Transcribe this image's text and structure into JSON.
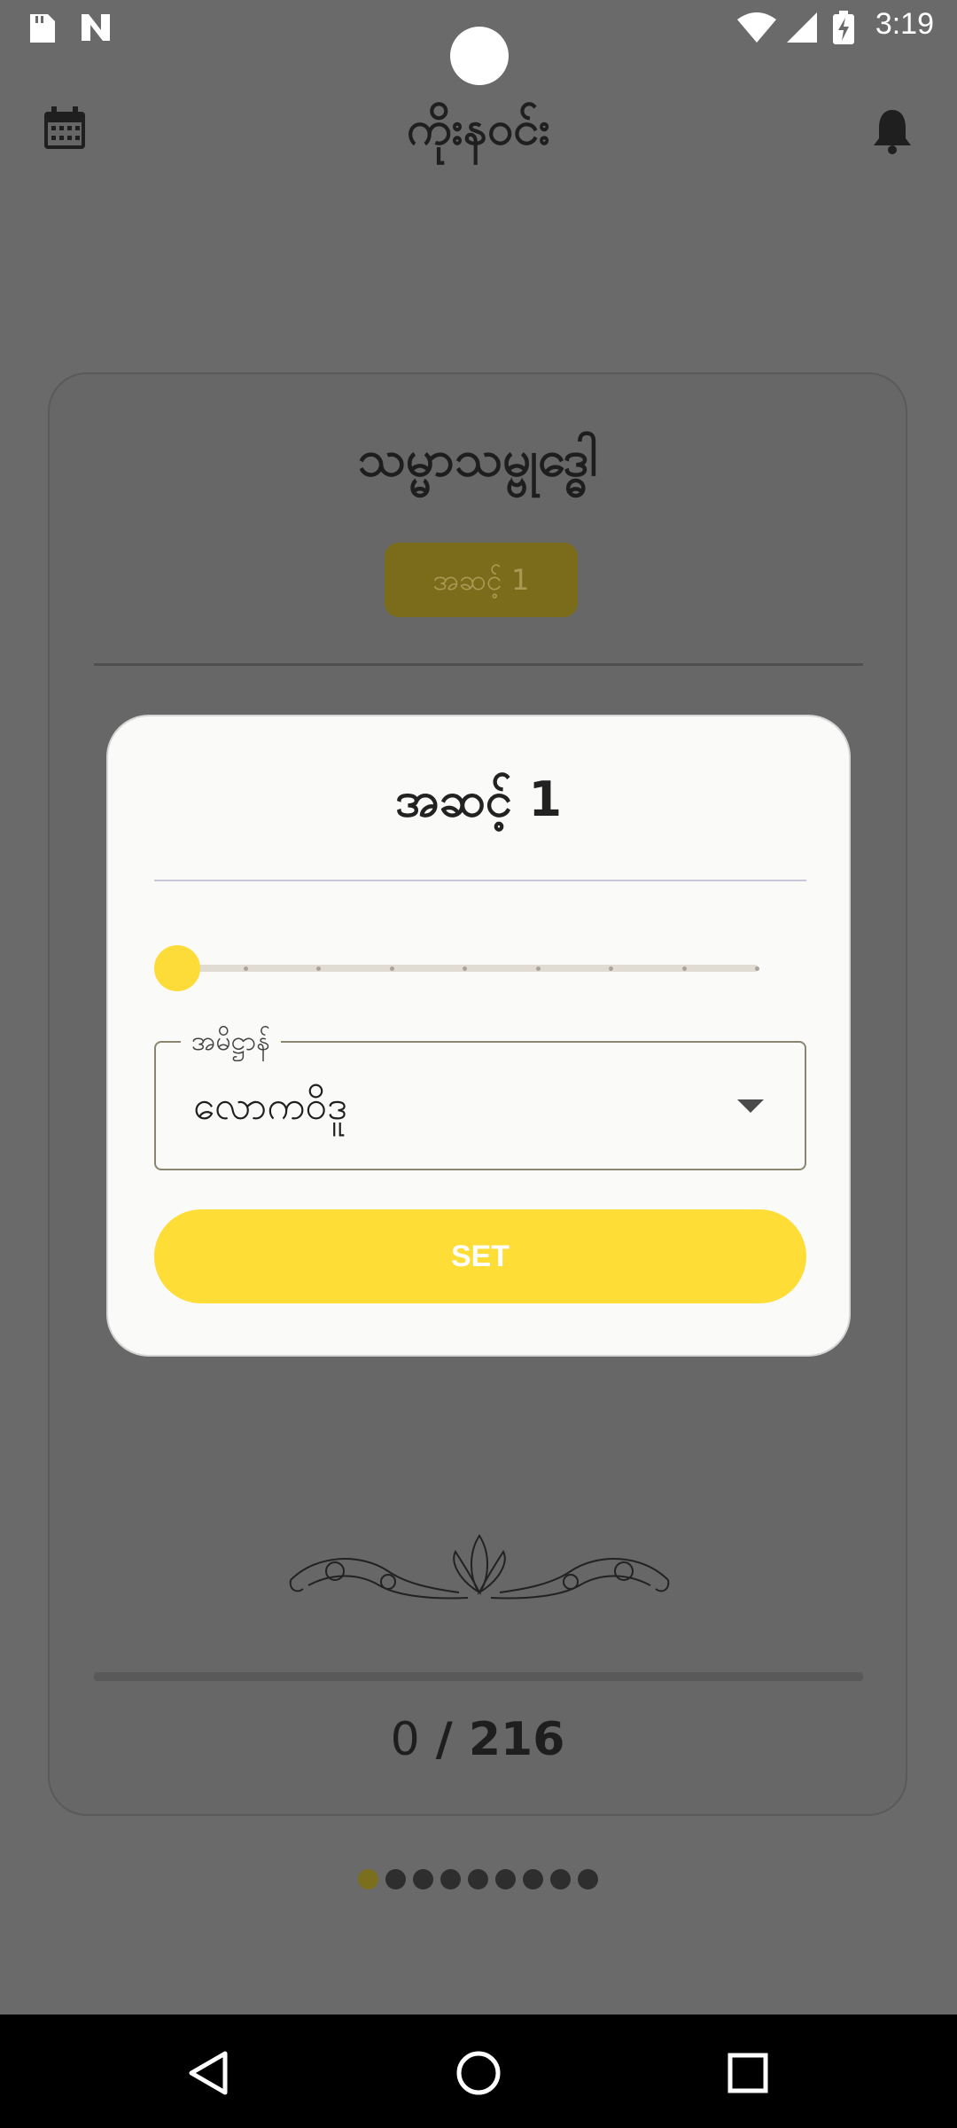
{
  "status_bar": {
    "time": "3:19"
  },
  "app_bar": {
    "title": "ကိုးနဝင်း"
  },
  "card": {
    "title": "သမ္မာသမ္ဗုဒ္ဓေါ",
    "level_badge": "အဆင့် 1",
    "progress_current": "0",
    "progress_separator": " / ",
    "progress_total": "216",
    "progress_fraction": 0
  },
  "pager": {
    "count": 9,
    "active_index": 0
  },
  "dialog": {
    "title": "အဆင့် 1",
    "slider": {
      "value": 1,
      "min": 1,
      "max": 9
    },
    "select": {
      "label": "အမိဋ္ဌာန်",
      "value": "လောကဝိဒူ"
    },
    "set_label": "SET"
  },
  "colors": {
    "accent": "#fddc3a",
    "scrim": "#6a6a6a",
    "dialog_bg": "#fafaf8"
  }
}
